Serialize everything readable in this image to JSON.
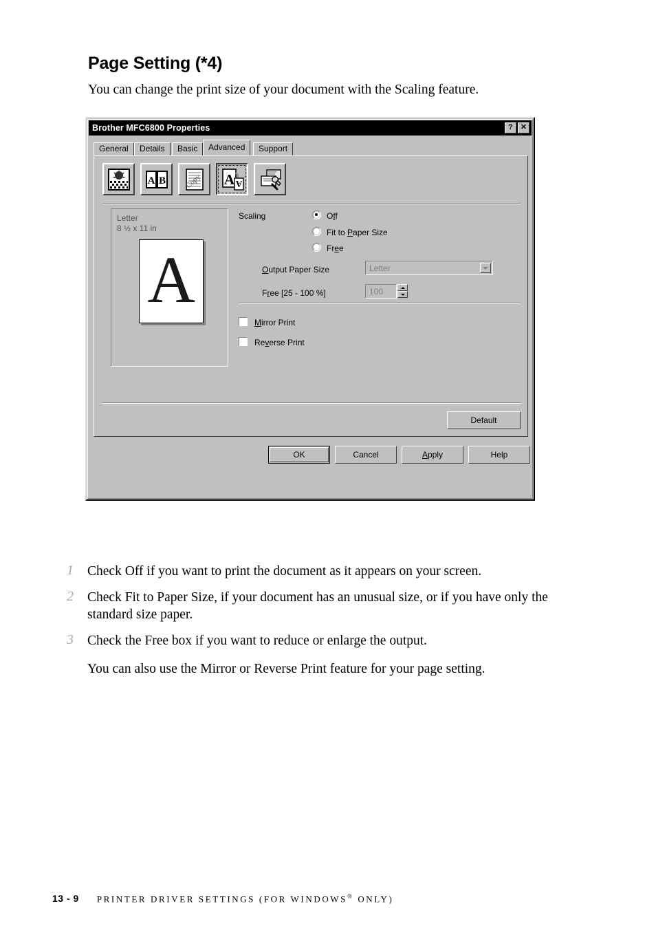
{
  "page": {
    "heading": "Page Setting  (*4)",
    "intro": "You can change the print size of your document with the Scaling feature."
  },
  "dialog": {
    "title": "Brother MFC6800 Properties",
    "titlebar_buttons": [
      {
        "name": "help-button",
        "label": "?"
      },
      {
        "name": "close-button",
        "label": "✕"
      }
    ],
    "tabs": [
      {
        "label": "General",
        "active": false
      },
      {
        "label": "Details",
        "active": false
      },
      {
        "label": "Basic",
        "active": false
      },
      {
        "label": "Advanced",
        "active": true
      },
      {
        "label": "Support",
        "active": false
      }
    ],
    "toolbar_icons": [
      {
        "name": "quality-halftone-icon",
        "selected": false
      },
      {
        "name": "multipage-ab-icon",
        "selected": false
      },
      {
        "name": "watermark-copy-icon",
        "selected": false
      },
      {
        "name": "page-setting-icon",
        "selected": true
      },
      {
        "name": "device-options-wrench-icon",
        "selected": false
      }
    ],
    "preview": {
      "paper_name": "Letter",
      "paper_size": "8 ½ x 11 in",
      "sheet_glyph": "A"
    },
    "scaling": {
      "group_label": "Scaling",
      "options": [
        {
          "label": "Off",
          "underline_index": 1,
          "selected": true
        },
        {
          "label": "Fit to Paper Size",
          "underline_index": 7,
          "selected": false
        },
        {
          "label": "Free",
          "underline_index": 2,
          "selected": false
        }
      ],
      "output_paper_size_label": "Output Paper Size",
      "output_paper_size_value": "Letter",
      "free_label": "Free [25 - 100 %]",
      "free_value": "100",
      "disabled": true
    },
    "checkboxes": [
      {
        "label": "Mirror Print",
        "checked": false
      },
      {
        "label": "Reverse Print",
        "checked": false
      }
    ],
    "default_button": "Default",
    "action_buttons": [
      {
        "label": "OK",
        "is_default": true
      },
      {
        "label": "Cancel",
        "is_default": false
      },
      {
        "label": "Apply",
        "is_default": false
      },
      {
        "label": "Help",
        "is_default": false
      }
    ]
  },
  "steps": [
    {
      "num": "1",
      "text": "Check Off if you want to print the document as it appears on your screen."
    },
    {
      "num": "2",
      "text": "Check Fit to Paper Size, if your document has an unusual size, or if you have only the standard size paper."
    },
    {
      "num": "3",
      "text": "Check the Free box if you want to reduce or enlarge the output."
    }
  ],
  "steps_note": "You can also use the Mirror or Reverse Print feature for your page setting.",
  "footer": {
    "page_number": "13 - 9",
    "title_prefix": "PRINTER DRIVER SETTINGS (FOR WINDOWS",
    "title_sup": "®",
    "title_suffix": " ONLY)"
  },
  "colors": {
    "window_face": "#c0c0c0",
    "titlebar": "#000000",
    "disabled_text": "#808080"
  }
}
